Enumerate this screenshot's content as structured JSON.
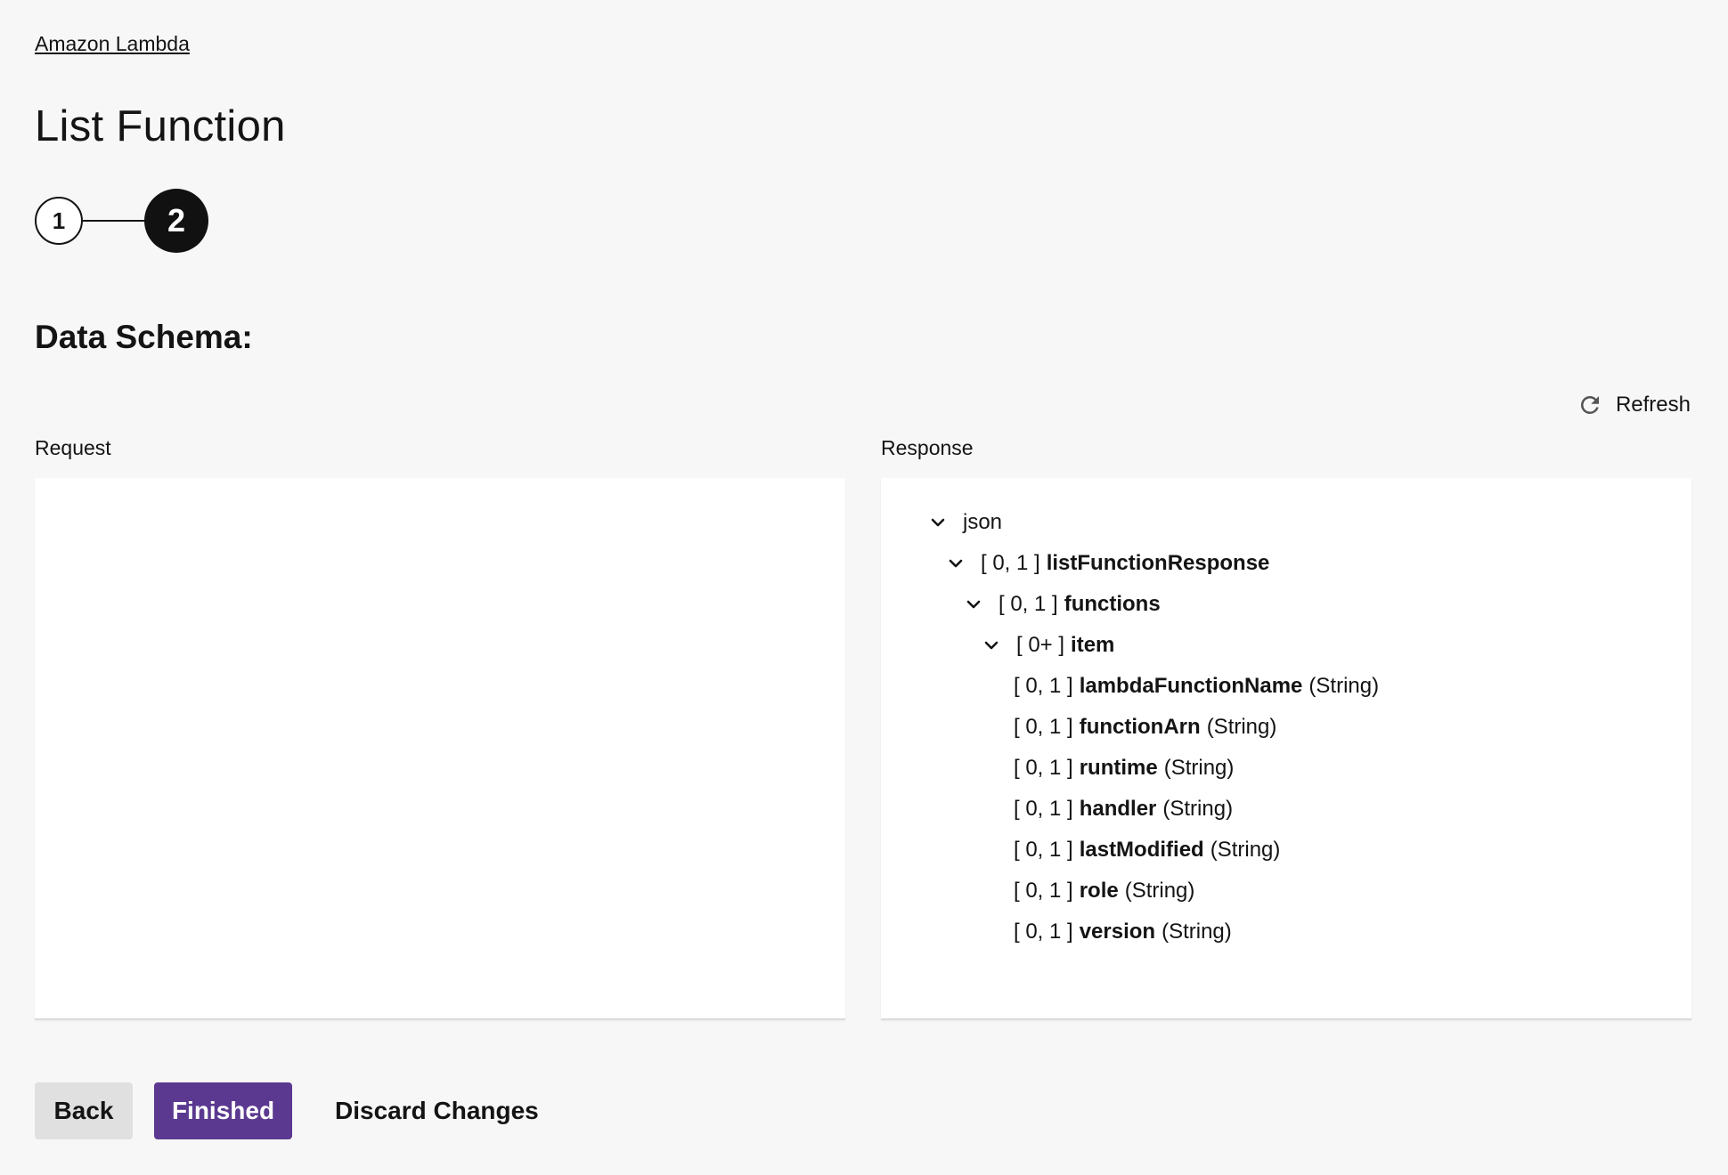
{
  "breadcrumb": {
    "label": "Amazon Lambda"
  },
  "page": {
    "title": "List Function"
  },
  "stepper": {
    "steps": [
      {
        "label": "1",
        "state": "completed"
      },
      {
        "label": "2",
        "state": "active"
      }
    ]
  },
  "schema": {
    "title": "Data Schema:",
    "refresh_label": "Refresh",
    "request_label": "Request",
    "response_label": "Response",
    "response_tree": [
      {
        "bracket": "",
        "name": "json",
        "type": "",
        "expandable": true,
        "bold": false
      },
      {
        "bracket": "[ 0, 1 ]",
        "name": "listFunctionResponse",
        "type": "",
        "expandable": true,
        "bold": true
      },
      {
        "bracket": "[ 0, 1 ]",
        "name": "functions",
        "type": "",
        "expandable": true,
        "bold": true
      },
      {
        "bracket": "[ 0+ ]",
        "name": "item",
        "type": "",
        "expandable": true,
        "bold": true
      },
      {
        "bracket": "[ 0, 1 ]",
        "name": "lambdaFunctionName",
        "type": "(String)",
        "expandable": false,
        "bold": true
      },
      {
        "bracket": "[ 0, 1 ]",
        "name": "functionArn",
        "type": "(String)",
        "expandable": false,
        "bold": true
      },
      {
        "bracket": "[ 0, 1 ]",
        "name": "runtime",
        "type": "(String)",
        "expandable": false,
        "bold": true
      },
      {
        "bracket": "[ 0, 1 ]",
        "name": "handler",
        "type": "(String)",
        "expandable": false,
        "bold": true
      },
      {
        "bracket": "[ 0, 1 ]",
        "name": "lastModified",
        "type": "(String)",
        "expandable": false,
        "bold": true
      },
      {
        "bracket": "[ 0, 1 ]",
        "name": "role",
        "type": "(String)",
        "expandable": false,
        "bold": true
      },
      {
        "bracket": "[ 0, 1 ]",
        "name": "version",
        "type": "(String)",
        "expandable": false,
        "bold": true
      }
    ]
  },
  "actions": {
    "back_label": "Back",
    "finished_label": "Finished",
    "discard_label": "Discard Changes"
  },
  "colors": {
    "primary": "#5b3990",
    "active_step": "#111111",
    "secondary_button": "#e0e0e0",
    "background": "#f7f7f7"
  },
  "icons": {
    "refresh": "refresh-icon",
    "chevron": "chevron-down-icon"
  }
}
